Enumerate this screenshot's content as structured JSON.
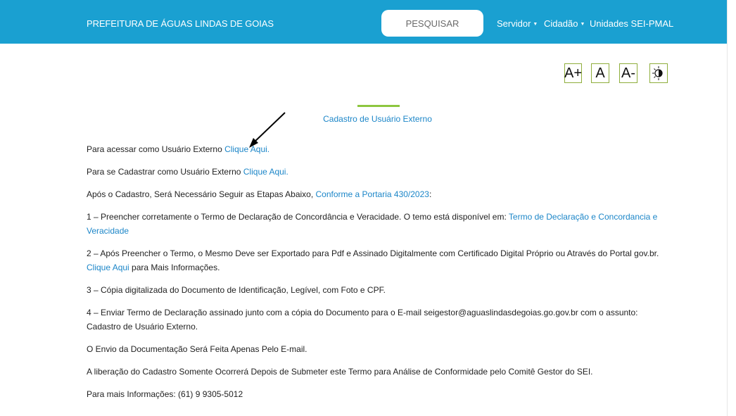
{
  "header": {
    "brand": "PREFEITURA DE ÁGUAS LINDAS DE GOIAS",
    "search_label": "PESQUISAR",
    "nav": [
      "Servidor",
      "Cidadão",
      "Unidades SEI-PMAL"
    ]
  },
  "accessibility": {
    "increase": "A+",
    "normal": "A",
    "decrease": "A-"
  },
  "section": {
    "title": "Cadastro de Usuário Externo"
  },
  "content": {
    "p1_text": "Para acessar como Usuário Externo ",
    "p1_link": "Clique Aqui.",
    "p2_text": "Para se Cadastrar como Usuário Externo ",
    "p2_link": "Clique Aqui.",
    "p3_text": "Após o Cadastro, Será Necessário Seguir as Etapas Abaixo, ",
    "p3_link": "Conforme a Portaria 430/2023",
    "p3_end": ":",
    "s1_text": "1 – Preencher corretamente o Termo de Declaração de Concordância e Veracidade. O temo está disponível em: ",
    "s1_link": "Termo de Declaração e Concordancia e Veracidade",
    "s2_text": "2 – Após Preencher o Termo, o Mesmo Deve ser Exportado para Pdf e Assinado Digitalmente com Certificado Digital Próprio ou Através do Portal gov.br. ",
    "s2_link": "Clique Aqui",
    "s2_end": " para Mais Informações.",
    "s3_text": "3 – Cópia digitalizada do Documento de Identificação, Legível, com Foto e CPF.",
    "s4_text": "4 – Enviar Termo de Declaração assinado junto com a cópia do Documento para o E-mail seigestor@aguaslindasdegoias.go.gov.br com o assunto: Cadastro de Usuário Externo.",
    "p4_text": "O Envio da Documentação Será Feita Apenas Pelo E-mail.",
    "p5_text": "A liberação do Cadastro Somente Ocorrerá Depois de Submeter este Termo para Análise de Conformidade pelo Comitê Gestor do SEI.",
    "p6_text": "Para mais Informações: (61) 9 9305-5012"
  },
  "colors": {
    "navbar": "#1aa0d1",
    "link": "#1c86c8",
    "accent": "#8dc63f"
  }
}
